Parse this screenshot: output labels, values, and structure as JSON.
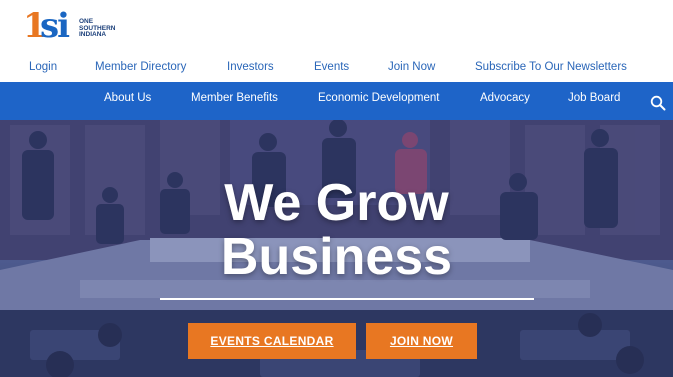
{
  "logo": {
    "mark": "1si",
    "mark_one": "1",
    "mark_si": "si",
    "lines": [
      "ONE",
      "SOUTHERN",
      "INDIANA"
    ]
  },
  "utility_nav": [
    "Login",
    "Member Directory",
    "Investors",
    "Events",
    "Join Now",
    "Subscribe To Our Newsletters"
  ],
  "main_nav": [
    "About Us",
    "Member Benefits",
    "Economic Development",
    "Advocacy",
    "Job Board"
  ],
  "search_icon": "search-icon",
  "hero": {
    "title_line1": "We Grow",
    "title_line2": "Business",
    "buttons": {
      "events": "EVENTS CALENDAR",
      "join": "JOIN NOW"
    }
  },
  "colors": {
    "brand_orange": "#e87722",
    "brand_blue": "#1e64c8",
    "link_blue": "#2a66b8"
  }
}
